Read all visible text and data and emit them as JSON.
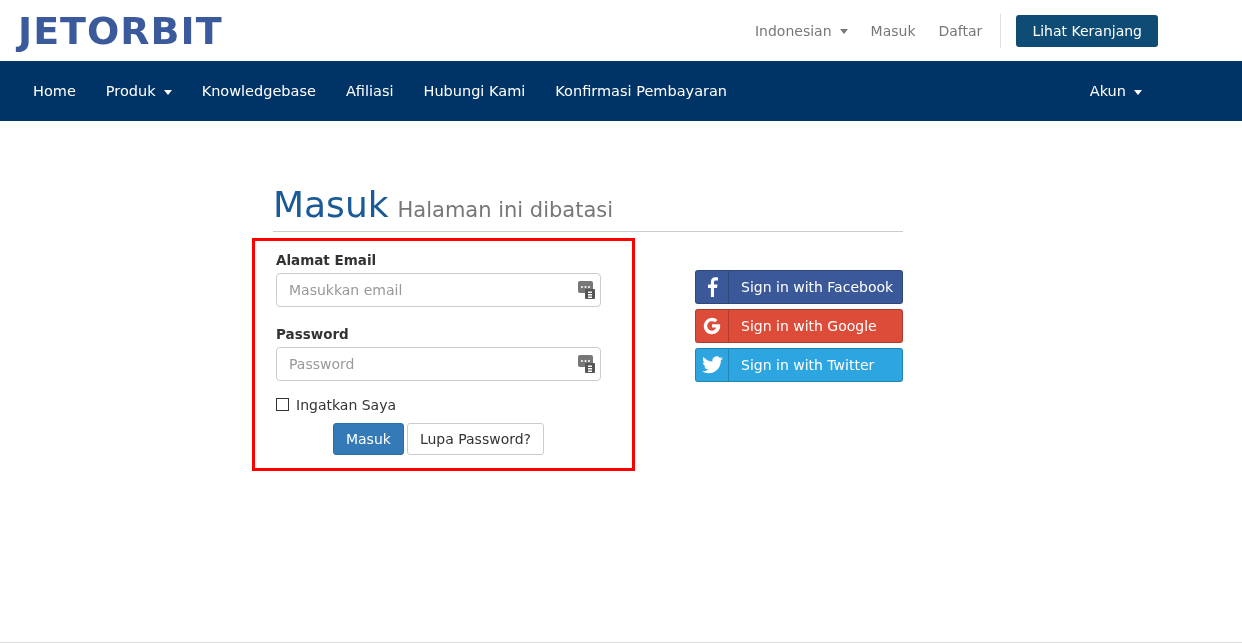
{
  "logo": {
    "text": "JETORBIT"
  },
  "top_links": [
    {
      "label": "Indonesian",
      "dropdown": true
    },
    {
      "label": "Masuk",
      "dropdown": false
    },
    {
      "label": "Daftar",
      "dropdown": false
    }
  ],
  "cart_button": {
    "label": "Lihat Keranjang"
  },
  "nav": {
    "items": [
      {
        "label": "Home",
        "dropdown": false
      },
      {
        "label": "Produk",
        "dropdown": true
      },
      {
        "label": "Knowledgebase",
        "dropdown": false
      },
      {
        "label": "Afiliasi",
        "dropdown": false
      },
      {
        "label": "Hubungi Kami",
        "dropdown": false
      },
      {
        "label": "Konfirmasi Pembayaran",
        "dropdown": false
      }
    ],
    "right_items": [
      {
        "label": "Akun",
        "dropdown": true
      }
    ]
  },
  "page": {
    "title": "Masuk",
    "subtitle": "Halaman ini dibatasi"
  },
  "login_form": {
    "fields": [
      {
        "label": "Alamat Email",
        "placeholder": "Masukkan email"
      },
      {
        "label": "Password",
        "placeholder": "Password"
      }
    ],
    "remember": {
      "label": "Ingatkan Saya",
      "checked": false
    },
    "buttons": [
      {
        "label": "Masuk",
        "kind": "primary"
      },
      {
        "label": "Lupa Password?",
        "kind": "default"
      }
    ]
  },
  "social_buttons": [
    {
      "label": "Sign in with Facebook",
      "kind": "facebook",
      "color": "#3b5998"
    },
    {
      "label": "Sign in with Google",
      "kind": "google",
      "color": "#dd4b39"
    },
    {
      "label": "Sign in with Twitter",
      "kind": "twitter",
      "color": "#2ca5e0"
    }
  ]
}
